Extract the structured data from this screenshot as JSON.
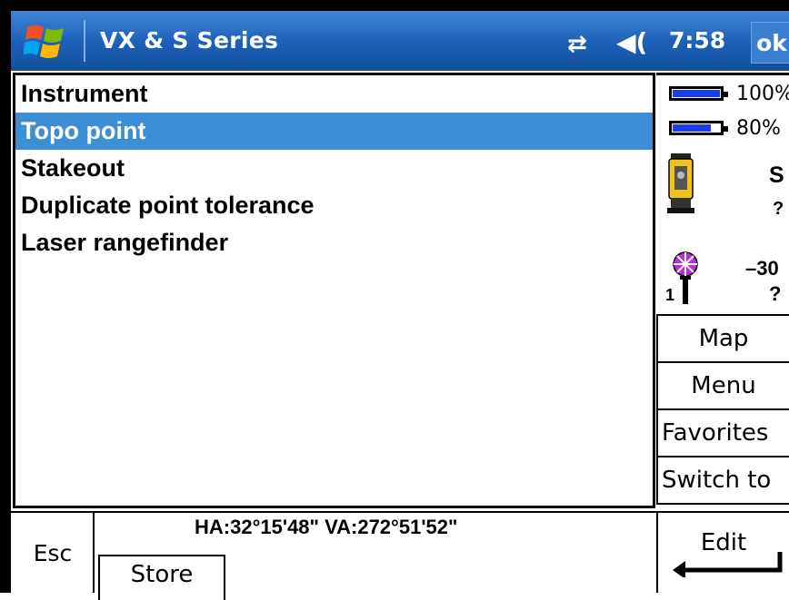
{
  "titlebar": {
    "title": "VX & S Series",
    "time": "7:58",
    "ok_label": "ok",
    "start_icon": "windows-flag-icon",
    "connection_icon": "connectivity-icon",
    "volume_icon": "speaker-icon"
  },
  "list": {
    "items": [
      {
        "label": "Instrument",
        "selected": false
      },
      {
        "label": "Topo point",
        "selected": true
      },
      {
        "label": "Stakeout",
        "selected": false
      },
      {
        "label": "Duplicate point tolerance",
        "selected": false
      },
      {
        "label": "Laser rangefinder",
        "selected": false
      }
    ]
  },
  "status": {
    "battery1_pct": "100%",
    "battery1_level": 1.0,
    "battery2_pct": "80%",
    "battery2_level": 0.8,
    "instrument_label": "S",
    "instrument_value": "?",
    "target_height": "–30",
    "target_number": "1",
    "target_value": "?"
  },
  "side_buttons": {
    "map": "Map",
    "menu": "Menu",
    "favorites": "Favorites",
    "switch_to": "Switch to"
  },
  "bottom": {
    "esc_label": "Esc",
    "angles": "HA:32°15'48\"  VA:272°51'52\"",
    "store_label": "Store",
    "edit_label": "Edit"
  },
  "colors": {
    "titlebar": "#1b5fb6",
    "selection": "#3c8fd4",
    "battery_fill": "#1a3ef0"
  }
}
